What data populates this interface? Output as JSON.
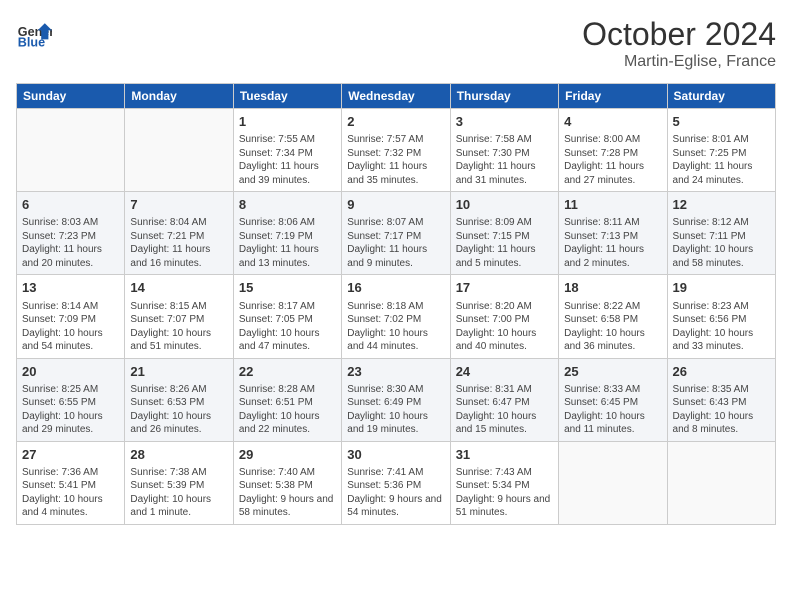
{
  "header": {
    "logo_general": "General",
    "logo_blue": "Blue",
    "month": "October 2024",
    "location": "Martin-Eglise, France"
  },
  "days_of_week": [
    "Sunday",
    "Monday",
    "Tuesday",
    "Wednesday",
    "Thursday",
    "Friday",
    "Saturday"
  ],
  "weeks": [
    [
      {
        "day": "",
        "detail": ""
      },
      {
        "day": "",
        "detail": ""
      },
      {
        "day": "1",
        "detail": "Sunrise: 7:55 AM\nSunset: 7:34 PM\nDaylight: 11 hours and 39 minutes."
      },
      {
        "day": "2",
        "detail": "Sunrise: 7:57 AM\nSunset: 7:32 PM\nDaylight: 11 hours and 35 minutes."
      },
      {
        "day": "3",
        "detail": "Sunrise: 7:58 AM\nSunset: 7:30 PM\nDaylight: 11 hours and 31 minutes."
      },
      {
        "day": "4",
        "detail": "Sunrise: 8:00 AM\nSunset: 7:28 PM\nDaylight: 11 hours and 27 minutes."
      },
      {
        "day": "5",
        "detail": "Sunrise: 8:01 AM\nSunset: 7:25 PM\nDaylight: 11 hours and 24 minutes."
      }
    ],
    [
      {
        "day": "6",
        "detail": "Sunrise: 8:03 AM\nSunset: 7:23 PM\nDaylight: 11 hours and 20 minutes."
      },
      {
        "day": "7",
        "detail": "Sunrise: 8:04 AM\nSunset: 7:21 PM\nDaylight: 11 hours and 16 minutes."
      },
      {
        "day": "8",
        "detail": "Sunrise: 8:06 AM\nSunset: 7:19 PM\nDaylight: 11 hours and 13 minutes."
      },
      {
        "day": "9",
        "detail": "Sunrise: 8:07 AM\nSunset: 7:17 PM\nDaylight: 11 hours and 9 minutes."
      },
      {
        "day": "10",
        "detail": "Sunrise: 8:09 AM\nSunset: 7:15 PM\nDaylight: 11 hours and 5 minutes."
      },
      {
        "day": "11",
        "detail": "Sunrise: 8:11 AM\nSunset: 7:13 PM\nDaylight: 11 hours and 2 minutes."
      },
      {
        "day": "12",
        "detail": "Sunrise: 8:12 AM\nSunset: 7:11 PM\nDaylight: 10 hours and 58 minutes."
      }
    ],
    [
      {
        "day": "13",
        "detail": "Sunrise: 8:14 AM\nSunset: 7:09 PM\nDaylight: 10 hours and 54 minutes."
      },
      {
        "day": "14",
        "detail": "Sunrise: 8:15 AM\nSunset: 7:07 PM\nDaylight: 10 hours and 51 minutes."
      },
      {
        "day": "15",
        "detail": "Sunrise: 8:17 AM\nSunset: 7:05 PM\nDaylight: 10 hours and 47 minutes."
      },
      {
        "day": "16",
        "detail": "Sunrise: 8:18 AM\nSunset: 7:02 PM\nDaylight: 10 hours and 44 minutes."
      },
      {
        "day": "17",
        "detail": "Sunrise: 8:20 AM\nSunset: 7:00 PM\nDaylight: 10 hours and 40 minutes."
      },
      {
        "day": "18",
        "detail": "Sunrise: 8:22 AM\nSunset: 6:58 PM\nDaylight: 10 hours and 36 minutes."
      },
      {
        "day": "19",
        "detail": "Sunrise: 8:23 AM\nSunset: 6:56 PM\nDaylight: 10 hours and 33 minutes."
      }
    ],
    [
      {
        "day": "20",
        "detail": "Sunrise: 8:25 AM\nSunset: 6:55 PM\nDaylight: 10 hours and 29 minutes."
      },
      {
        "day": "21",
        "detail": "Sunrise: 8:26 AM\nSunset: 6:53 PM\nDaylight: 10 hours and 26 minutes."
      },
      {
        "day": "22",
        "detail": "Sunrise: 8:28 AM\nSunset: 6:51 PM\nDaylight: 10 hours and 22 minutes."
      },
      {
        "day": "23",
        "detail": "Sunrise: 8:30 AM\nSunset: 6:49 PM\nDaylight: 10 hours and 19 minutes."
      },
      {
        "day": "24",
        "detail": "Sunrise: 8:31 AM\nSunset: 6:47 PM\nDaylight: 10 hours and 15 minutes."
      },
      {
        "day": "25",
        "detail": "Sunrise: 8:33 AM\nSunset: 6:45 PM\nDaylight: 10 hours and 11 minutes."
      },
      {
        "day": "26",
        "detail": "Sunrise: 8:35 AM\nSunset: 6:43 PM\nDaylight: 10 hours and 8 minutes."
      }
    ],
    [
      {
        "day": "27",
        "detail": "Sunrise: 7:36 AM\nSunset: 5:41 PM\nDaylight: 10 hours and 4 minutes."
      },
      {
        "day": "28",
        "detail": "Sunrise: 7:38 AM\nSunset: 5:39 PM\nDaylight: 10 hours and 1 minute."
      },
      {
        "day": "29",
        "detail": "Sunrise: 7:40 AM\nSunset: 5:38 PM\nDaylight: 9 hours and 58 minutes."
      },
      {
        "day": "30",
        "detail": "Sunrise: 7:41 AM\nSunset: 5:36 PM\nDaylight: 9 hours and 54 minutes."
      },
      {
        "day": "31",
        "detail": "Sunrise: 7:43 AM\nSunset: 5:34 PM\nDaylight: 9 hours and 51 minutes."
      },
      {
        "day": "",
        "detail": ""
      },
      {
        "day": "",
        "detail": ""
      }
    ]
  ]
}
